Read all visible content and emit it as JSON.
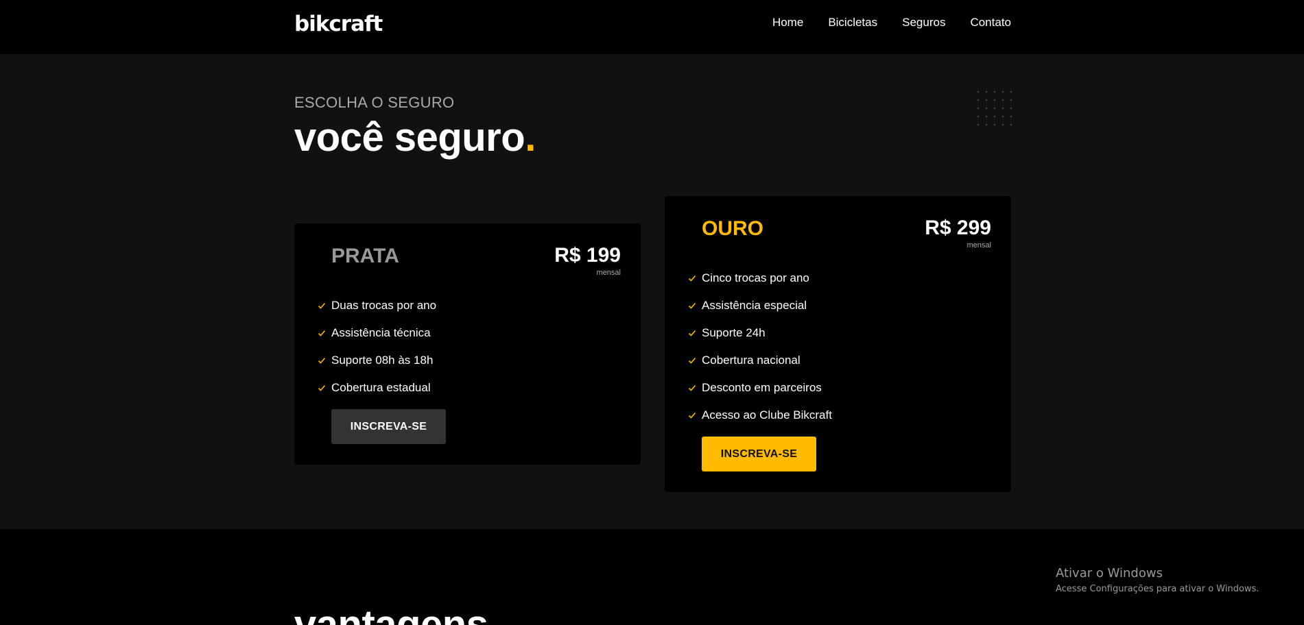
{
  "header": {
    "logo": "bikcraft",
    "nav": [
      "Home",
      "Bicicletas",
      "Seguros",
      "Contato"
    ]
  },
  "hero": {
    "eyebrow": "ESCOLHA O SEGURO",
    "title": "você seguro",
    "title_dot": "."
  },
  "plans": [
    {
      "name": "PRATA",
      "price": "R$ 199",
      "period": "mensal",
      "features": [
        "Duas trocas por ano",
        "Assistência técnica",
        "Suporte 08h às 18h",
        "Cobertura estadual"
      ],
      "button": "INSCREVA-SE"
    },
    {
      "name": "OURO",
      "price": "R$ 299",
      "period": "mensal",
      "features": [
        "Cinco trocas por ano",
        "Assistência especial",
        "Suporte 24h",
        "Cobertura nacional",
        "Desconto em parceiros",
        "Acesso ao Clube Bikcraft"
      ],
      "button": "INSCREVA-SE"
    }
  ],
  "next_section": {
    "title": "vantagens"
  },
  "watermark": {
    "title": "Ativar o Windows",
    "subtitle": "Acesse Configurações para ativar o Windows."
  },
  "colors": {
    "accent": "#ffbb00",
    "section_bg": "#111111",
    "card_bg": "#000000",
    "button_gray": "#333333"
  },
  "icons": {
    "feature_bullet": "check-icon",
    "decoration": "dot-grid-icon"
  }
}
